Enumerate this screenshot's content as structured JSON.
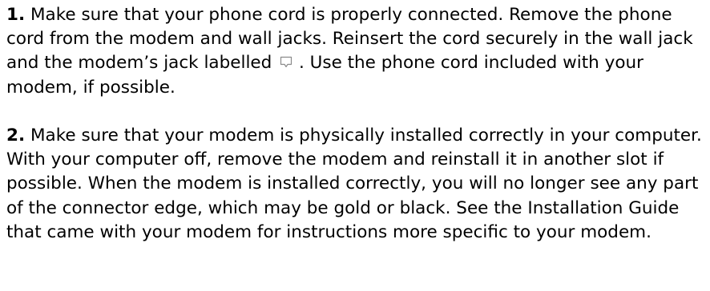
{
  "steps": [
    {
      "number": "1.",
      "text_before_icon": " Make sure that your phone cord is properly connected. Remove the phone cord from the modem and wall jacks. Reinsert the cord securely in the wall jack and the modem’s jack labelled ",
      "icon": "phone-jack-icon",
      "text_after_icon": " . Use the phone cord included with your modem, if possible."
    },
    {
      "number": "2.",
      "text": " Make sure that your modem is physically installed correctly in your computer. With your computer off, remove the modem and reinstall it in another slot if possible. When the modem is installed correctly, you will no longer see any part of the connector edge, which may be gold or black. See the Installation Guide that came with your modem for instructions more specific to your modem."
    }
  ],
  "colors": {
    "text": "#000000",
    "icon_stroke": "#8a8a8a",
    "background": "#ffffff"
  }
}
